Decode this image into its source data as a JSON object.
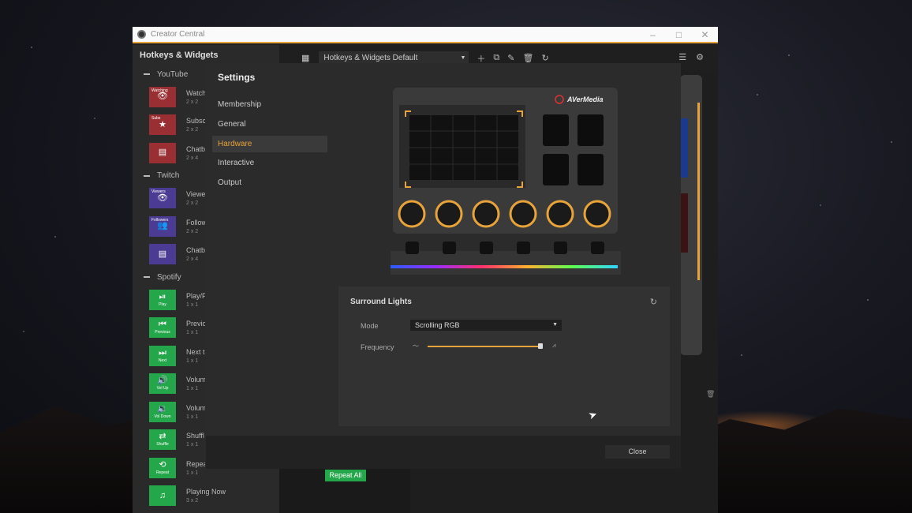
{
  "app": {
    "title": "Creator Central",
    "window_controls": [
      "–",
      "□",
      "✕"
    ]
  },
  "left_panel": {
    "title": "Hotkeys & Widgets",
    "sections": [
      {
        "name": "YouTube",
        "items": [
          {
            "tile_label": "Watching",
            "tile_glyph": "👁",
            "name": "Watch",
            "size": "2 x 2",
            "color": "red"
          },
          {
            "tile_label": "Subs",
            "tile_glyph": "★",
            "name": "Subsc",
            "size": "2 x 2",
            "color": "red"
          },
          {
            "tile_label": "",
            "tile_glyph": "▤",
            "name": "Chatb",
            "size": "2 x 4",
            "color": "red"
          }
        ]
      },
      {
        "name": "Twitch",
        "items": [
          {
            "tile_label": "Viewers",
            "tile_glyph": "👁",
            "name": "Viewe",
            "size": "2 x 2",
            "color": "purple"
          },
          {
            "tile_label": "Followers",
            "tile_glyph": "👥",
            "name": "Follow",
            "size": "2 x 2",
            "color": "purple"
          },
          {
            "tile_label": "",
            "tile_glyph": "▤",
            "name": "Chatb",
            "size": "2 x 4",
            "color": "purple"
          }
        ]
      },
      {
        "name": "Spotify",
        "items": [
          {
            "tile_label": "Play",
            "tile_glyph": "⏯",
            "name": "Play/P",
            "size": "1 x 1",
            "color": "green"
          },
          {
            "tile_label": "Previous",
            "tile_glyph": "⏮",
            "name": "Previo",
            "size": "1 x 1",
            "color": "green"
          },
          {
            "tile_label": "Next",
            "tile_glyph": "⏭",
            "name": "Next tr",
            "size": "1 x 1",
            "color": "green"
          },
          {
            "tile_label": "Vol Up",
            "tile_glyph": "🔊",
            "name": "Volum",
            "size": "1 x 1",
            "color": "green"
          },
          {
            "tile_label": "Vol Down",
            "tile_glyph": "🔉",
            "name": "Volum",
            "size": "1 x 1",
            "color": "green"
          },
          {
            "tile_label": "Shuffle",
            "tile_glyph": "⇄",
            "name": "Shuffl",
            "size": "1 x 1",
            "color": "green"
          },
          {
            "tile_label": "Repeat",
            "tile_glyph": "⟲",
            "name": "Repea",
            "size": "1 x 1",
            "color": "green"
          },
          {
            "tile_label": "",
            "tile_glyph": "♫",
            "name": "Playing Now",
            "size": "3 x 2",
            "color": "green"
          }
        ]
      }
    ]
  },
  "toolbar": {
    "profile": "Hotkeys & Widgets Default"
  },
  "background": {
    "repeat_all_label": "Repeat All"
  },
  "settings": {
    "title": "Settings",
    "nav": [
      "Membership",
      "General",
      "Hardware",
      "Interactive",
      "Output"
    ],
    "active_nav": "Hardware",
    "device_brand": "AVerMedia",
    "surround": {
      "title": "Surround Lights",
      "mode_label": "Mode",
      "mode_value": "Scrolling RGB",
      "frequency_label": "Frequency",
      "frequency_level": 0.99
    },
    "close_label": "Close"
  },
  "colors": {
    "accent": "#e8a33a",
    "youtube": "#9a2f33",
    "twitch": "#4c3b93",
    "spotify": "#24a74a"
  }
}
